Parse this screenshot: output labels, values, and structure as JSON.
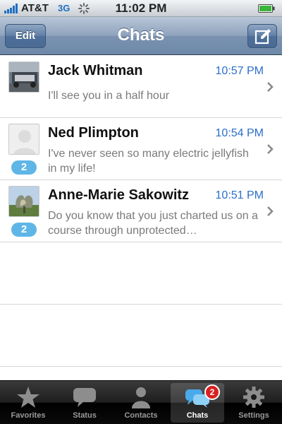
{
  "status_bar": {
    "carrier": "AT&T",
    "network": "3G",
    "time": "11:02 PM",
    "icons": [
      "signal-bars-icon",
      "activity-spinner-icon",
      "battery-icon"
    ]
  },
  "nav": {
    "title": "Chats",
    "edit_label": "Edit",
    "compose_icon": "compose-icon"
  },
  "chats": [
    {
      "name": "Jack Whitman",
      "time": "10:57 PM",
      "preview": "I'll see you in a half hour",
      "unread": null,
      "avatar": "photo-car"
    },
    {
      "name": "Ned Plimpton",
      "time": "10:54 PM",
      "preview": "I've never seen so many electric jellyfish in my life!",
      "unread": "2",
      "avatar": "placeholder-silhouette"
    },
    {
      "name": "Anne-Marie Sakowitz",
      "time": "10:51 PM",
      "preview": "Do you know that you just charted us on a course through unprotected…",
      "unread": "2",
      "avatar": "photo-sculpture"
    }
  ],
  "tabs": [
    {
      "label": "Favorites",
      "icon": "star-icon",
      "active": false
    },
    {
      "label": "Status",
      "icon": "speech-bubble-icon",
      "active": false
    },
    {
      "label": "Contacts",
      "icon": "person-icon",
      "active": false
    },
    {
      "label": "Chats",
      "icon": "chat-bubbles-icon",
      "active": true,
      "badge": "2"
    },
    {
      "label": "Settings",
      "icon": "gear-icon",
      "active": false
    }
  ],
  "colors": {
    "time_text": "#2a6fc9",
    "unread_badge": "#5fb6e6",
    "tab_badge": "#d92020",
    "nav_bar": "#7a93b1"
  }
}
